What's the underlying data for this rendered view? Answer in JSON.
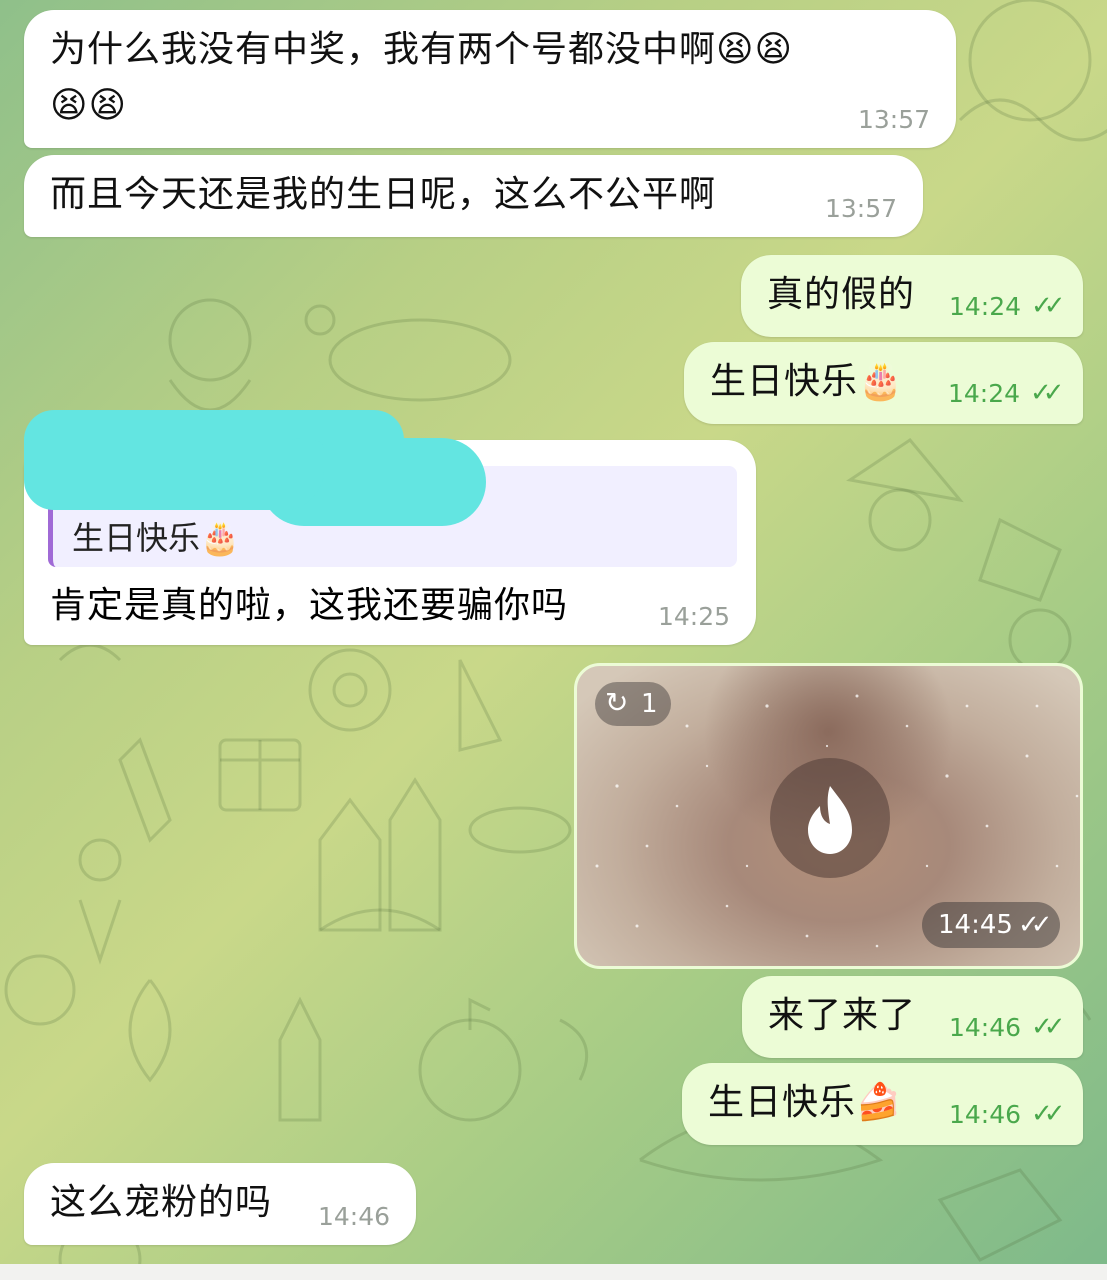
{
  "messages": [
    {
      "text_line1": "为什么我没有中奖，我有两个号都没中啊😫😫",
      "text_line2": "😫😫",
      "time": "13:57"
    },
    {
      "text": "而且今天还是我的生日呢，这么不公平啊",
      "time": "13:57"
    },
    {
      "text": "真的假的",
      "time": "14:24",
      "status": "✓✓"
    },
    {
      "text": "生日快乐🎂",
      "time": "14:24",
      "status": "✓✓"
    },
    {
      "reply_quote": "生日快乐🎂",
      "text": "肯定是真的啦，这我还要骗你吗",
      "time": "14:25"
    },
    {
      "video_replay_count": "1",
      "time": "14:45",
      "status": "✓✓"
    },
    {
      "text": "来了来了",
      "time": "14:46",
      "status": "✓✓"
    },
    {
      "text": "生日快乐🍰",
      "time": "14:46",
      "status": "✓✓"
    },
    {
      "text": "这么宠粉的吗",
      "time": "14:46"
    }
  ],
  "icons": {
    "replay": "replay-icon",
    "fire": "fire-icon",
    "read_ticks": "double-check-icon"
  },
  "colors": {
    "incoming_bubble": "#ffffff",
    "outgoing_bubble": "#ecfcd6",
    "time_outgoing": "#4aa84c",
    "redaction": "#63e5e1"
  }
}
